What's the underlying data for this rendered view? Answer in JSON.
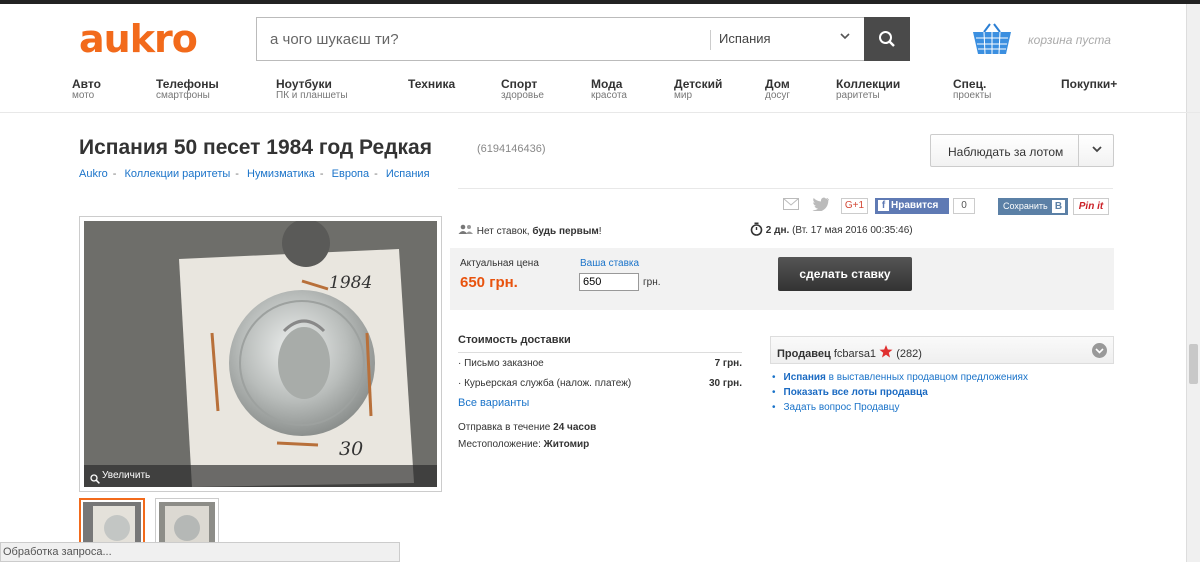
{
  "header": {
    "logo": "aukro",
    "search_placeholder": "а чого шукаєш ти?",
    "search_category": "Испания",
    "cart_text": "корзина пуста"
  },
  "nav": [
    {
      "title": "Авто",
      "sub": "мото"
    },
    {
      "title": "Телефоны",
      "sub": "смартфоны"
    },
    {
      "title": "Ноутбуки",
      "sub": "ПК и планшеты"
    },
    {
      "title": "Техника",
      "sub": ""
    },
    {
      "title": "Спорт",
      "sub": "здоровье"
    },
    {
      "title": "Мода",
      "sub": "красота"
    },
    {
      "title": "Детский",
      "sub": "мир"
    },
    {
      "title": "Дом",
      "sub": "досуг"
    },
    {
      "title": "Коллекции",
      "sub": "раритеты"
    },
    {
      "title": "Спец.",
      "sub": "проекты"
    },
    {
      "title": "Покупки+",
      "sub": ""
    }
  ],
  "lot": {
    "title": "Испания 50 песет 1984 год Редкая",
    "id": "(6194146436)",
    "watch_label": "Наблюдать за лотом"
  },
  "breadcrumbs": [
    "Aukro",
    "Коллекции раритеты",
    "Нумизматика",
    "Европа",
    "Испания"
  ],
  "share": {
    "gplus": "G+1",
    "like": "Нравится",
    "like_count": "0",
    "vk": "Сохранить",
    "vk_letter": "B",
    "pinit": "Pin it"
  },
  "photo": {
    "zoom_label": "Увеличить",
    "year_text": "1984",
    "price_text": "30"
  },
  "bids": {
    "no_bids": "Нет ставок,",
    "be_first": "будь первым",
    "exclaim": "!",
    "time_left": "2 дн.",
    "end_date": "(Вт. 17 мая 2016 00:35:46)"
  },
  "price": {
    "current_label": "Актуальная цена",
    "your_bid_label": "Ваша ставка",
    "current_value": "650 грн.",
    "bid_value": "650",
    "currency": "грн.",
    "bid_button": "сделать ставку"
  },
  "delivery": {
    "header": "Стоимость доставки",
    "options": [
      {
        "name": "Письмо заказное",
        "price": "7 грн."
      },
      {
        "name": "Курьерская служба (налож. платеж)",
        "price": "30 грн."
      }
    ],
    "all_variants": "Все варианты",
    "shipping_prefix": "Отправка в течение",
    "shipping_value": "24 часов",
    "location_prefix": "Местоположение:",
    "location_value": "Житомир"
  },
  "seller": {
    "label": "Продавец",
    "name": "fcbarsa1",
    "rating": "(282)",
    "link1_bold": "Испания",
    "link1_rest": "в выставленных продавцом предложениях",
    "link2": "Показать все лоты продавца",
    "link3": "Задать вопрос Продавцу"
  },
  "status_bar": "Обработка запроса...",
  "colors": {
    "brand": "#f26a1b",
    "link": "#1a73c9",
    "price": "#e8530e"
  }
}
